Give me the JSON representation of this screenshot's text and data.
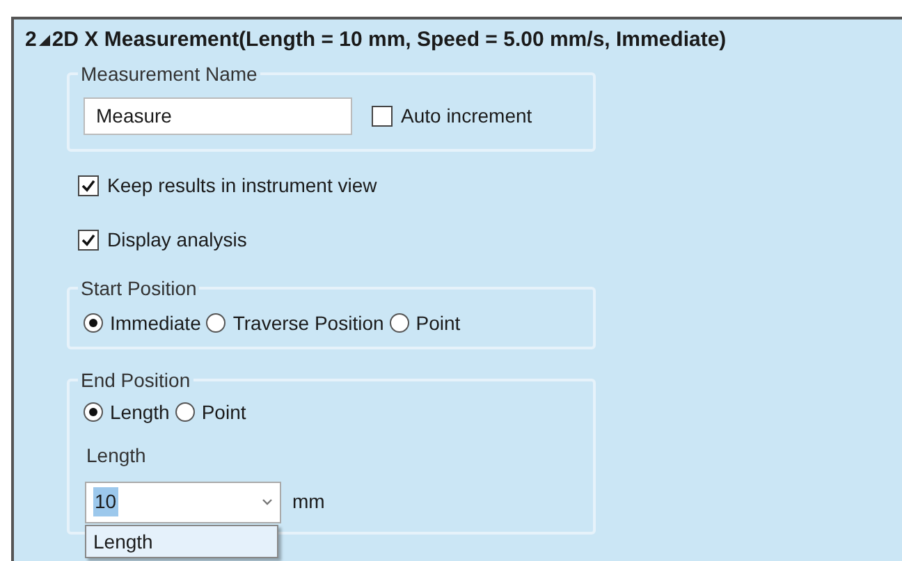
{
  "header": {
    "index": "2",
    "expanded": true,
    "title": "2D X Measurement(Length = 10 mm, Speed = 5.00 mm/s, Immediate)"
  },
  "measurement_name": {
    "legend": "Measurement Name",
    "value": "Measure",
    "auto_increment": {
      "label": "Auto increment",
      "checked": false
    }
  },
  "options": [
    {
      "label": "Keep results in instrument view",
      "checked": true
    },
    {
      "label": "Display analysis",
      "checked": true
    }
  ],
  "start_position": {
    "legend": "Start Position",
    "options": [
      {
        "label": "Immediate",
        "selected": true
      },
      {
        "label": "Traverse Position",
        "selected": false
      },
      {
        "label": "Point",
        "selected": false
      }
    ]
  },
  "end_position": {
    "legend": "End Position",
    "options": [
      {
        "label": "Length",
        "selected": true
      },
      {
        "label": "Point",
        "selected": false
      }
    ],
    "length_label": "Length",
    "length_value": "10",
    "unit": "mm",
    "dropdown_items": [
      "Length"
    ]
  }
}
